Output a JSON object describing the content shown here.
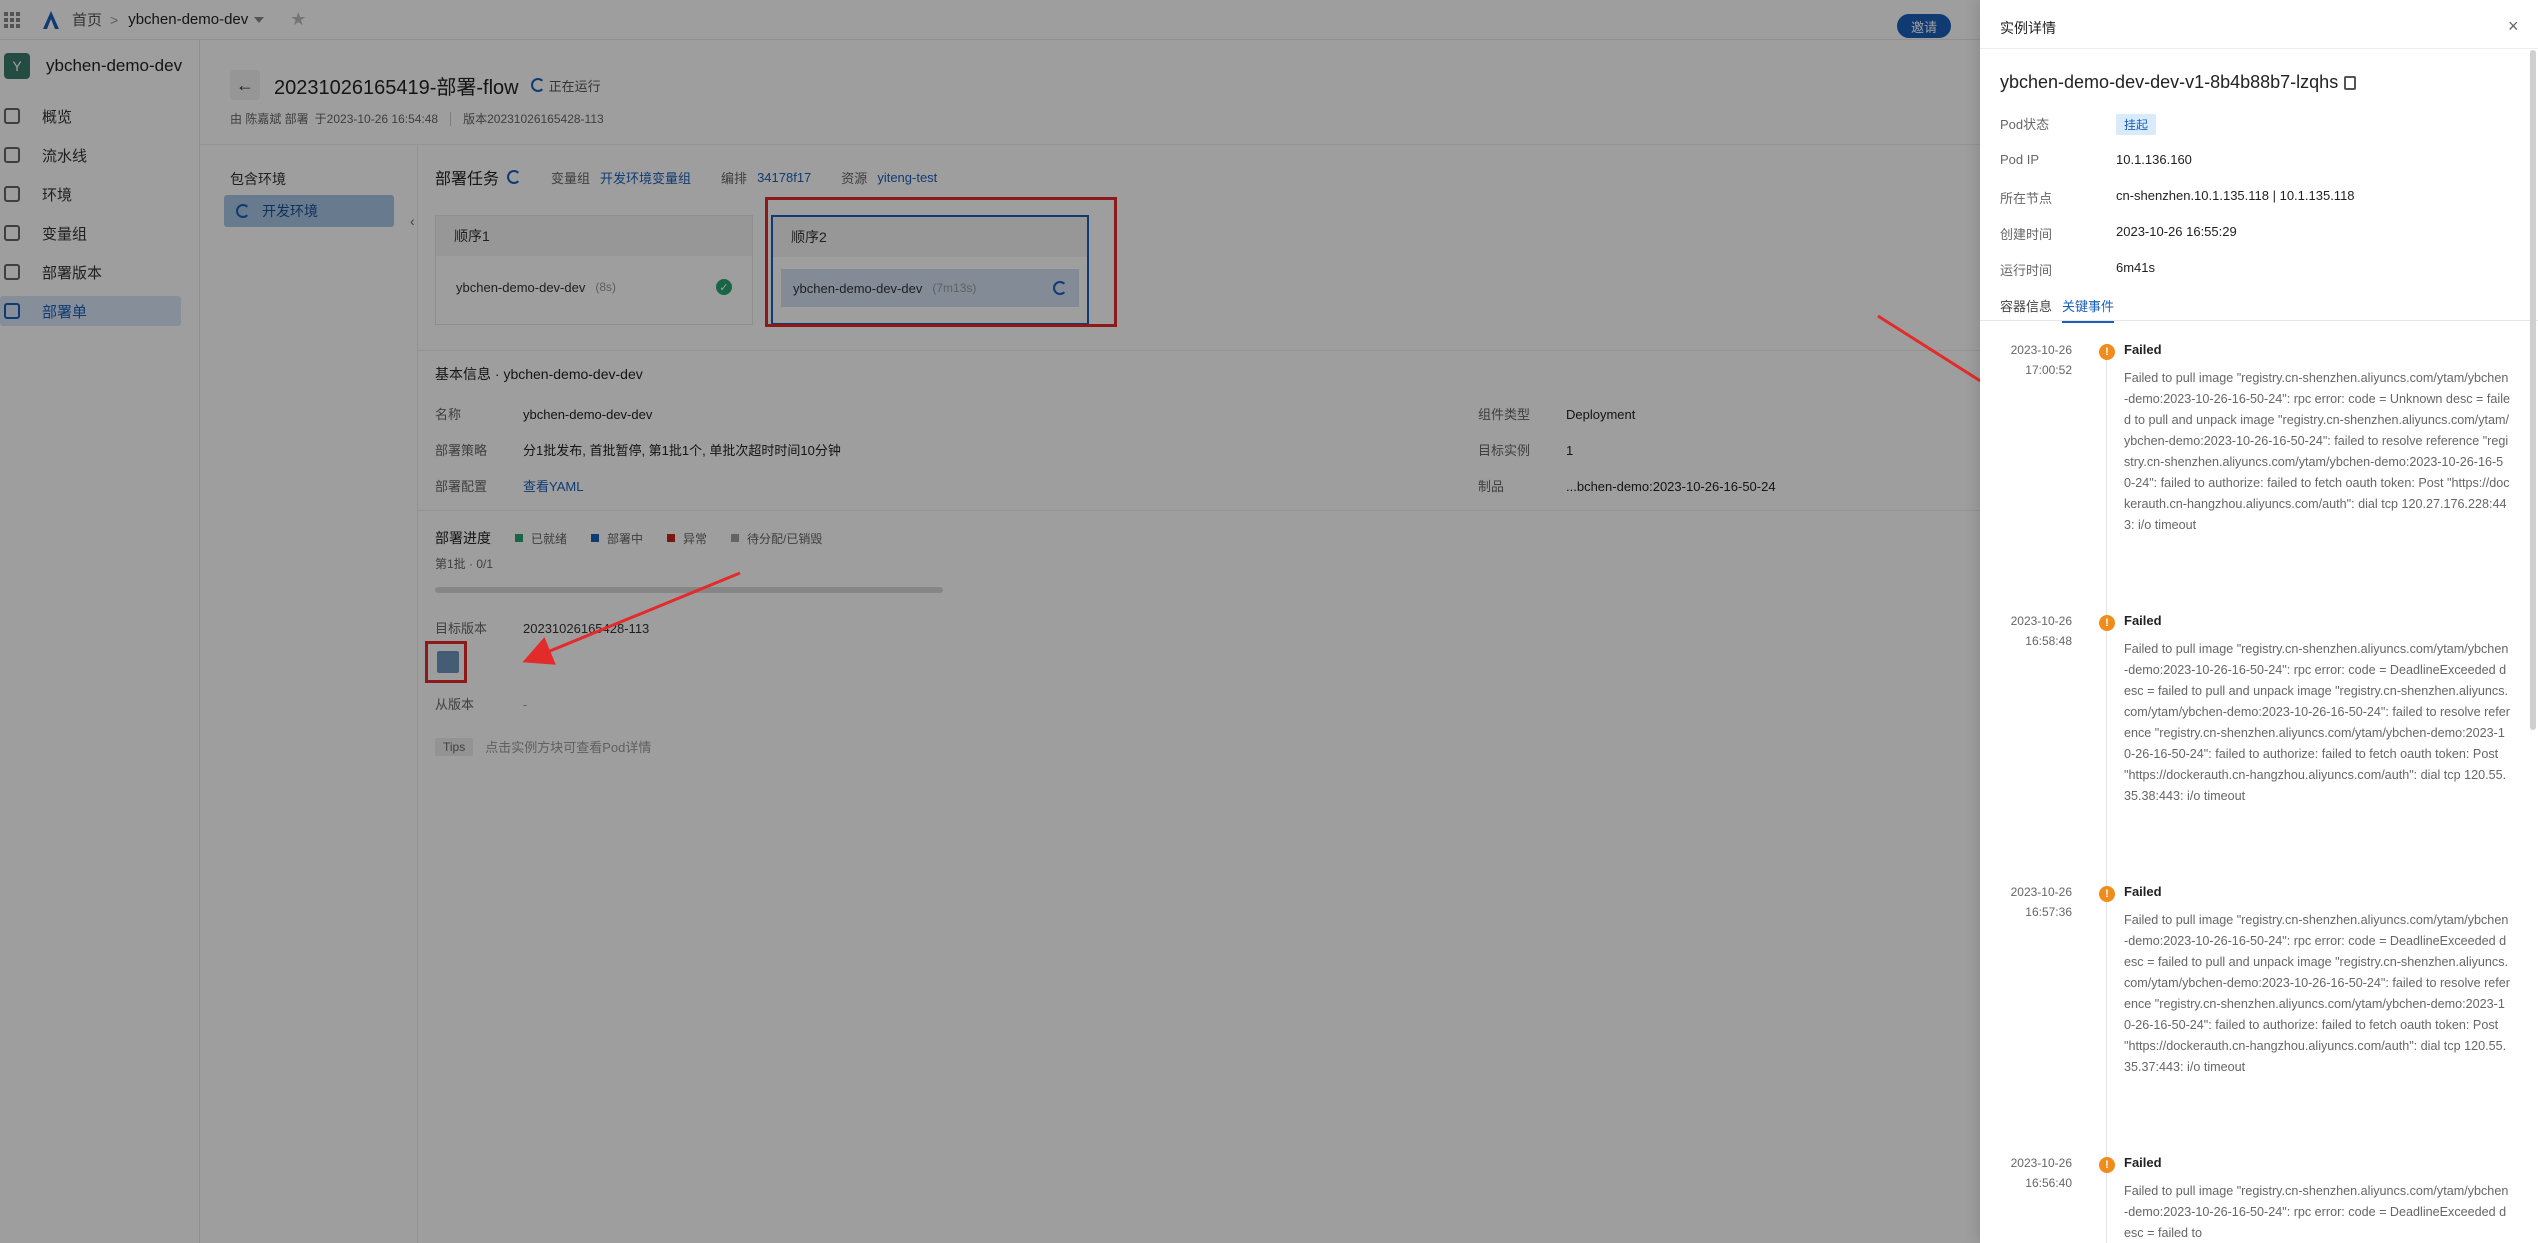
{
  "topbar": {
    "home": "首页",
    "separator": ">",
    "project": "ybchen-demo-dev",
    "invite": "邀请"
  },
  "sidebar": {
    "avatar": "Y",
    "project": "ybchen-demo-dev",
    "items": [
      {
        "label": "概览"
      },
      {
        "label": "流水线"
      },
      {
        "label": "环境"
      },
      {
        "label": "变量组"
      },
      {
        "label": "部署版本"
      },
      {
        "label": "部署单"
      }
    ]
  },
  "page": {
    "back": "←",
    "title": "20231026165419-部署-flow",
    "status": "正在运行",
    "deployer": "由 陈嘉斌 部署",
    "time": "于2023-10-26 16:54:48",
    "version": "版本20231026165428-113"
  },
  "envs": {
    "title": "包含环境",
    "item": "开发环境",
    "collapse": "‹"
  },
  "task": {
    "title": "部署任务",
    "var_group_label": "变量组",
    "var_group": "开发环境变量组",
    "orch_label": "编排",
    "orch": "34178f17",
    "resource_label": "资源",
    "resource": "yiteng-test"
  },
  "orders": [
    {
      "title": "顺序1",
      "service": "ybchen-demo-dev-dev",
      "duration": "(8s)",
      "check": "✓"
    },
    {
      "title": "顺序2",
      "service": "ybchen-demo-dev-dev",
      "duration": "(7m13s)"
    }
  ],
  "basic": {
    "title": "基本信息 · ybchen-demo-dev-dev",
    "name_label": "名称",
    "name": "ybchen-demo-dev-dev",
    "strategy_label": "部署策略",
    "strategy": "分1批发布, 首批暂停, 第1批1个, 单批次超时时间10分钟",
    "config_label": "部署配置",
    "config": "查看YAML",
    "type_label": "组件类型",
    "type": "Deployment",
    "target_inst_label": "目标实例",
    "target_inst": "1",
    "artifact_label": "制品",
    "artifact": "...bchen-demo:2023-10-26-16-50-24"
  },
  "progress": {
    "title": "部署进度",
    "legend": [
      "已就绪",
      "部署中",
      "异常",
      "待分配/已销毁"
    ],
    "legend_colors": [
      "#2ba471",
      "#1b5fb8",
      "#c4261d",
      "#a0a0a0"
    ],
    "batch": "第1批 · 0/1",
    "fraction": 0,
    "target_label": "目标版本",
    "target": "20231026165428-113",
    "from_label": "从版本",
    "from": "-",
    "tips_tag": "Tips",
    "tips": "点击实例方块可查看Pod详情"
  },
  "drawer": {
    "title": "实例详情",
    "close": "×",
    "pod": "ybchen-demo-dev-dev-v1-8b4b88b7-lzqhs",
    "status_label": "Pod状态",
    "status": "挂起",
    "ip_label": "Pod IP",
    "ip": "10.1.136.160",
    "node_label": "所在节点",
    "node": "cn-shenzhen.10.1.135.118 | 10.1.135.118",
    "created_label": "创建时间",
    "created": "2023-10-26 16:55:29",
    "uptime_label": "运行时间",
    "uptime": "6m41s",
    "tabs": [
      "容器信息",
      "关键事件"
    ],
    "events": [
      {
        "date": "2023-10-26",
        "time": "17:00:52",
        "title": "Failed",
        "message": "Failed to pull image \"registry.cn-shenzhen.aliyuncs.com/ytam/ybchen-demo:2023-10-26-16-50-24\": rpc error: code = Unknown desc = failed to pull and unpack image \"registry.cn-shenzhen.aliyuncs.com/ytam/ybchen-demo:2023-10-26-16-50-24\": failed to resolve reference \"registry.cn-shenzhen.aliyuncs.com/ytam/ybchen-demo:2023-10-26-16-50-24\": failed to authorize: failed to fetch oauth token: Post \"https://dockerauth.cn-hangzhou.aliyuncs.com/auth\": dial tcp 120.27.176.228:443: i/o timeout"
      },
      {
        "date": "2023-10-26",
        "time": "16:58:48",
        "title": "Failed",
        "message": "Failed to pull image \"registry.cn-shenzhen.aliyuncs.com/ytam/ybchen-demo:2023-10-26-16-50-24\": rpc error: code = DeadlineExceeded desc = failed to pull and unpack image \"registry.cn-shenzhen.aliyuncs.com/ytam/ybchen-demo:2023-10-26-16-50-24\": failed to resolve reference \"registry.cn-shenzhen.aliyuncs.com/ytam/ybchen-demo:2023-10-26-16-50-24\": failed to authorize: failed to fetch oauth token: Post \"https://dockerauth.cn-hangzhou.aliyuncs.com/auth\": dial tcp 120.55.35.38:443: i/o timeout"
      },
      {
        "date": "2023-10-26",
        "time": "16:57:36",
        "title": "Failed",
        "message": "Failed to pull image \"registry.cn-shenzhen.aliyuncs.com/ytam/ybchen-demo:2023-10-26-16-50-24\": rpc error: code = DeadlineExceeded desc = failed to pull and unpack image \"registry.cn-shenzhen.aliyuncs.com/ytam/ybchen-demo:2023-10-26-16-50-24\": failed to resolve reference \"registry.cn-shenzhen.aliyuncs.com/ytam/ybchen-demo:2023-10-26-16-50-24\": failed to authorize: failed to fetch oauth token: Post \"https://dockerauth.cn-hangzhou.aliyuncs.com/auth\": dial tcp 120.55.35.37:443: i/o timeout"
      },
      {
        "date": "2023-10-26",
        "time": "16:56:40",
        "title": "Failed",
        "message": "Failed to pull image \"registry.cn-shenzhen.aliyuncs.com/ytam/ybchen-demo:2023-10-26-16-50-24\": rpc error: code = DeadlineExceeded desc = failed to"
      }
    ]
  },
  "colors": {
    "accent": "#1b5fb8",
    "annotation_red": "#e32b2b",
    "warning": "#ef8c1c"
  }
}
